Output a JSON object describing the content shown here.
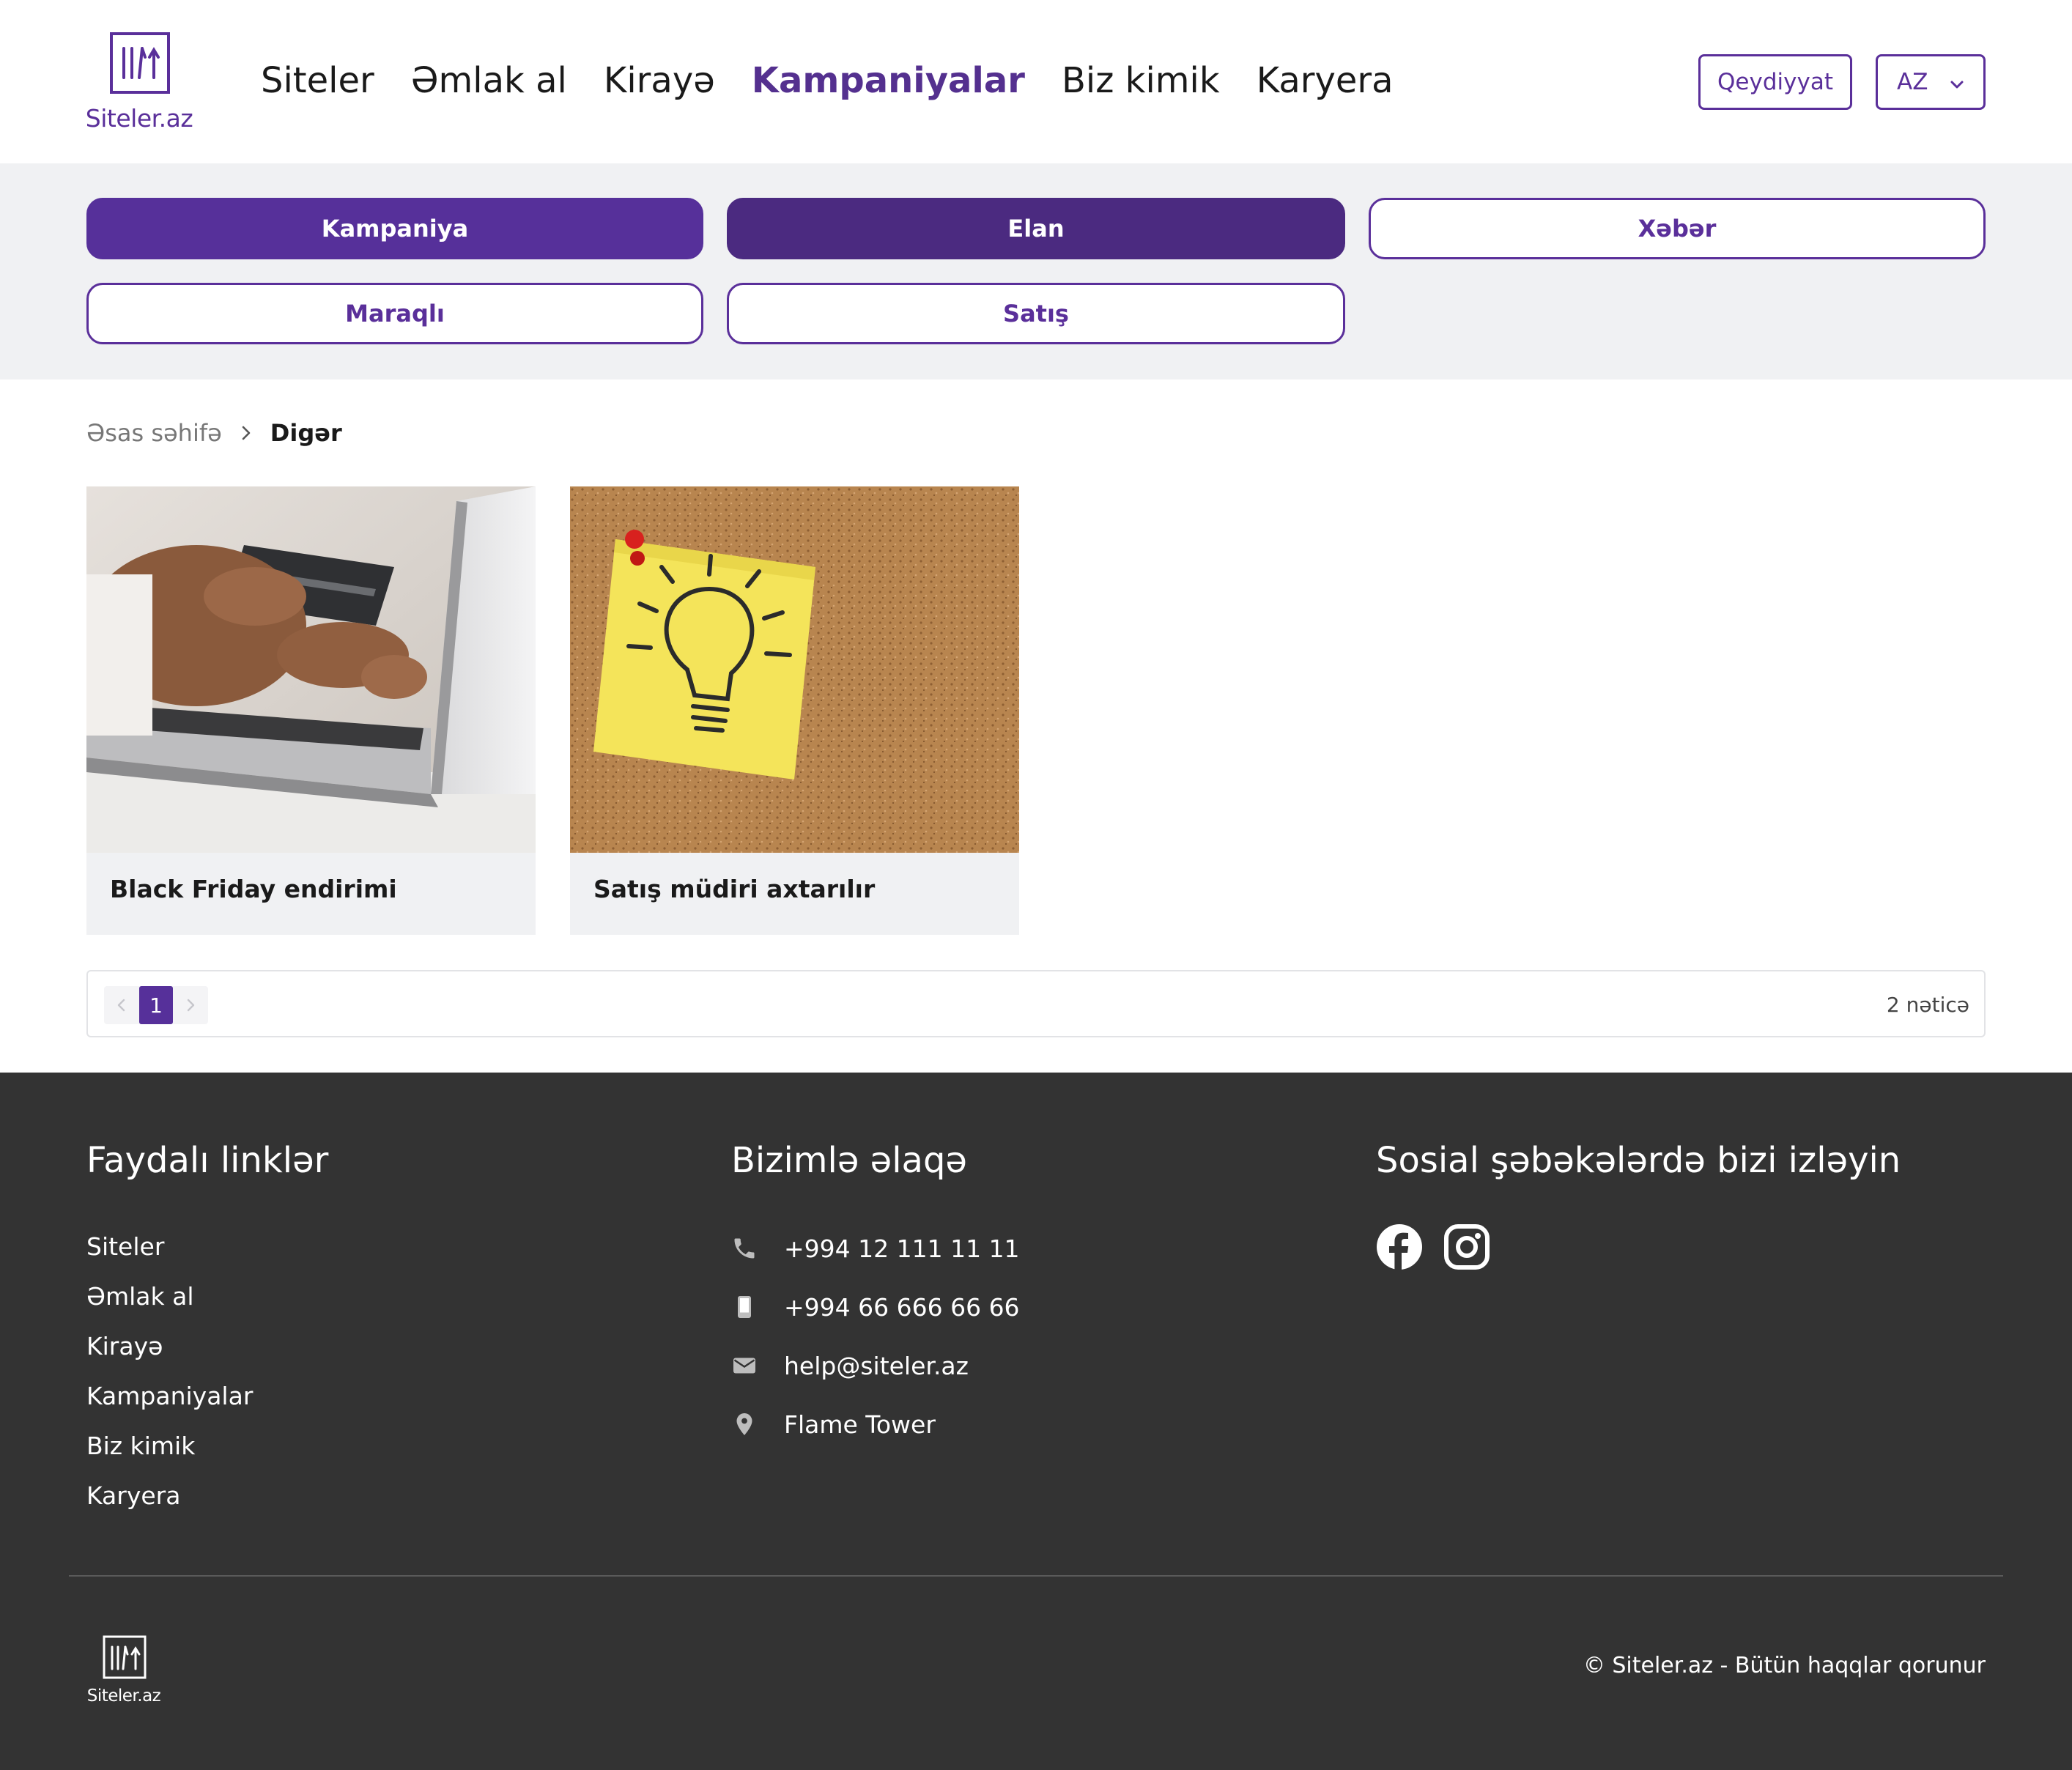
{
  "brand": {
    "name": "Siteler.az",
    "color": "#5a2f9a"
  },
  "header": {
    "nav": [
      {
        "label": "Siteler",
        "active": false
      },
      {
        "label": "Əmlak al",
        "active": false
      },
      {
        "label": "Kirayə",
        "active": false
      },
      {
        "label": "Kampaniyalar",
        "active": true
      },
      {
        "label": "Biz kimik",
        "active": false
      },
      {
        "label": "Karyera",
        "active": false
      }
    ],
    "register_label": "Qeydiyyat",
    "language": "AZ"
  },
  "filters": {
    "kampaniya": "Kampaniya",
    "elan": "Elan",
    "xeber": "Xəbər",
    "maraqli": "Maraqlı",
    "satis": "Satış"
  },
  "breadcrumb": {
    "home": "Əsas səhifə",
    "current": "Digər"
  },
  "cards": [
    {
      "title": "Black Friday endirimi",
      "image": "laptop-credit-card-photo"
    },
    {
      "title": "Satış müdiri axtarılır",
      "image": "lightbulb-sticky-note-photo"
    }
  ],
  "pagination": {
    "current_page": "1",
    "result_count": "2 nəticə"
  },
  "footer": {
    "useful_links_title": "Faydalı linklər",
    "useful_links": [
      "Siteler",
      "Əmlak al",
      "Kirayə",
      "Kampaniyalar",
      "Biz kimik",
      "Karyera"
    ],
    "contact_title": "Bizimlə əlaqə",
    "contacts": [
      {
        "icon": "phone-icon",
        "text": "+994 12 111 11 11"
      },
      {
        "icon": "mobile-icon",
        "text": "+994 66 666 66 66"
      },
      {
        "icon": "mail-icon",
        "text": "help@siteler.az"
      },
      {
        "icon": "location-icon",
        "text": "Flame Tower"
      }
    ],
    "social_title": "Sosial şəbəkələrdə bizi izləyin",
    "socials": [
      "facebook-icon",
      "instagram-icon"
    ],
    "brand": "Siteler.az",
    "copyright": "© Siteler.az - Bütün haqqlar qorunur"
  }
}
